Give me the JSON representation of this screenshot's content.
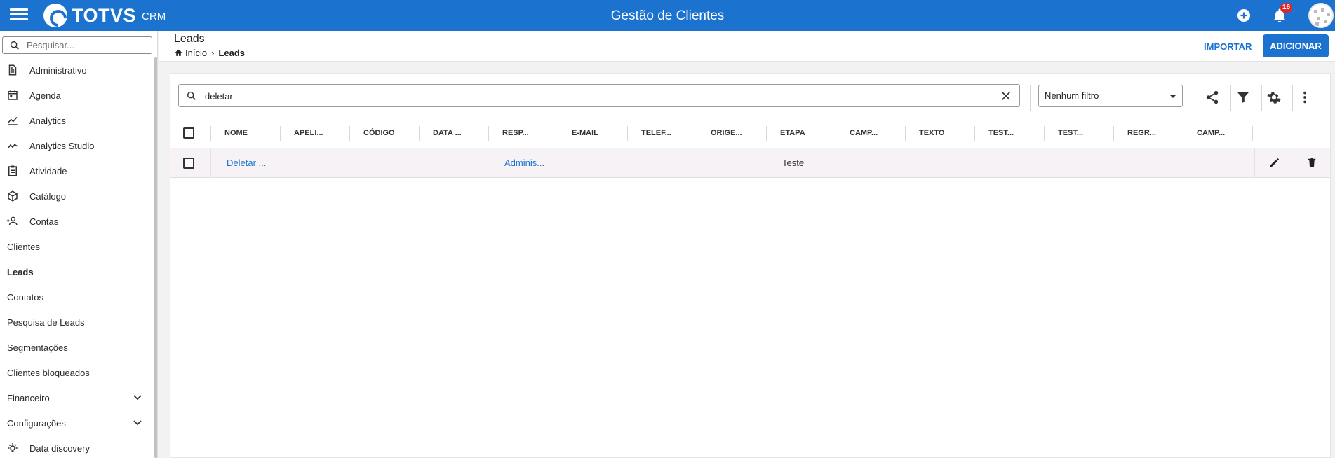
{
  "topbar": {
    "brand": "TOTVS",
    "brand_sub": "CRM",
    "title": "Gestão de Clientes",
    "notification_count": "16"
  },
  "sidebar": {
    "search_placeholder": "Pesquisar...",
    "items": [
      {
        "label": "Administrativo",
        "icon": "document-icon"
      },
      {
        "label": "Agenda",
        "icon": "calendar-icon"
      },
      {
        "label": "Analytics",
        "icon": "line-chart-icon"
      },
      {
        "label": "Analytics Studio",
        "icon": "trend-icon"
      },
      {
        "label": "Atividade",
        "icon": "clipboard-icon"
      },
      {
        "label": "Catálogo",
        "icon": "cube-icon"
      },
      {
        "label": "Contas",
        "icon": "people-add-icon"
      },
      {
        "label": "Clientes"
      },
      {
        "label": "Leads"
      },
      {
        "label": "Contatos"
      },
      {
        "label": "Pesquisa de Leads"
      },
      {
        "label": "Segmentações"
      },
      {
        "label": "Clientes bloqueados"
      },
      {
        "label": "Financeiro"
      },
      {
        "label": "Configurações"
      },
      {
        "label": "Data discovery",
        "icon": "lightbulb-icon"
      }
    ]
  },
  "header": {
    "title": "Leads",
    "breadcrumb": [
      "Início",
      "Leads"
    ],
    "import_label": "IMPORTAR",
    "add_label": "ADICIONAR"
  },
  "toolbar": {
    "search_value": "deletar",
    "filter_value": "Nenhum filtro"
  },
  "table": {
    "columns": [
      "NOME",
      "APELI...",
      "CÓDIGO",
      "DATA ...",
      "RESP...",
      "E-MAIL",
      "TELEF...",
      "ORIGE...",
      "ETAPA",
      "CAMP...",
      "TEXTO",
      "TEST...",
      "TEST...",
      "REGR...",
      "CAMP..."
    ],
    "rows": [
      {
        "nome": "Deletar ...",
        "responsavel": "Adminis...",
        "etapa": "Teste"
      }
    ]
  },
  "colors": {
    "primary": "#1b73cf",
    "badge": "#e0262b",
    "row_highlight": "#f7f2f6"
  }
}
